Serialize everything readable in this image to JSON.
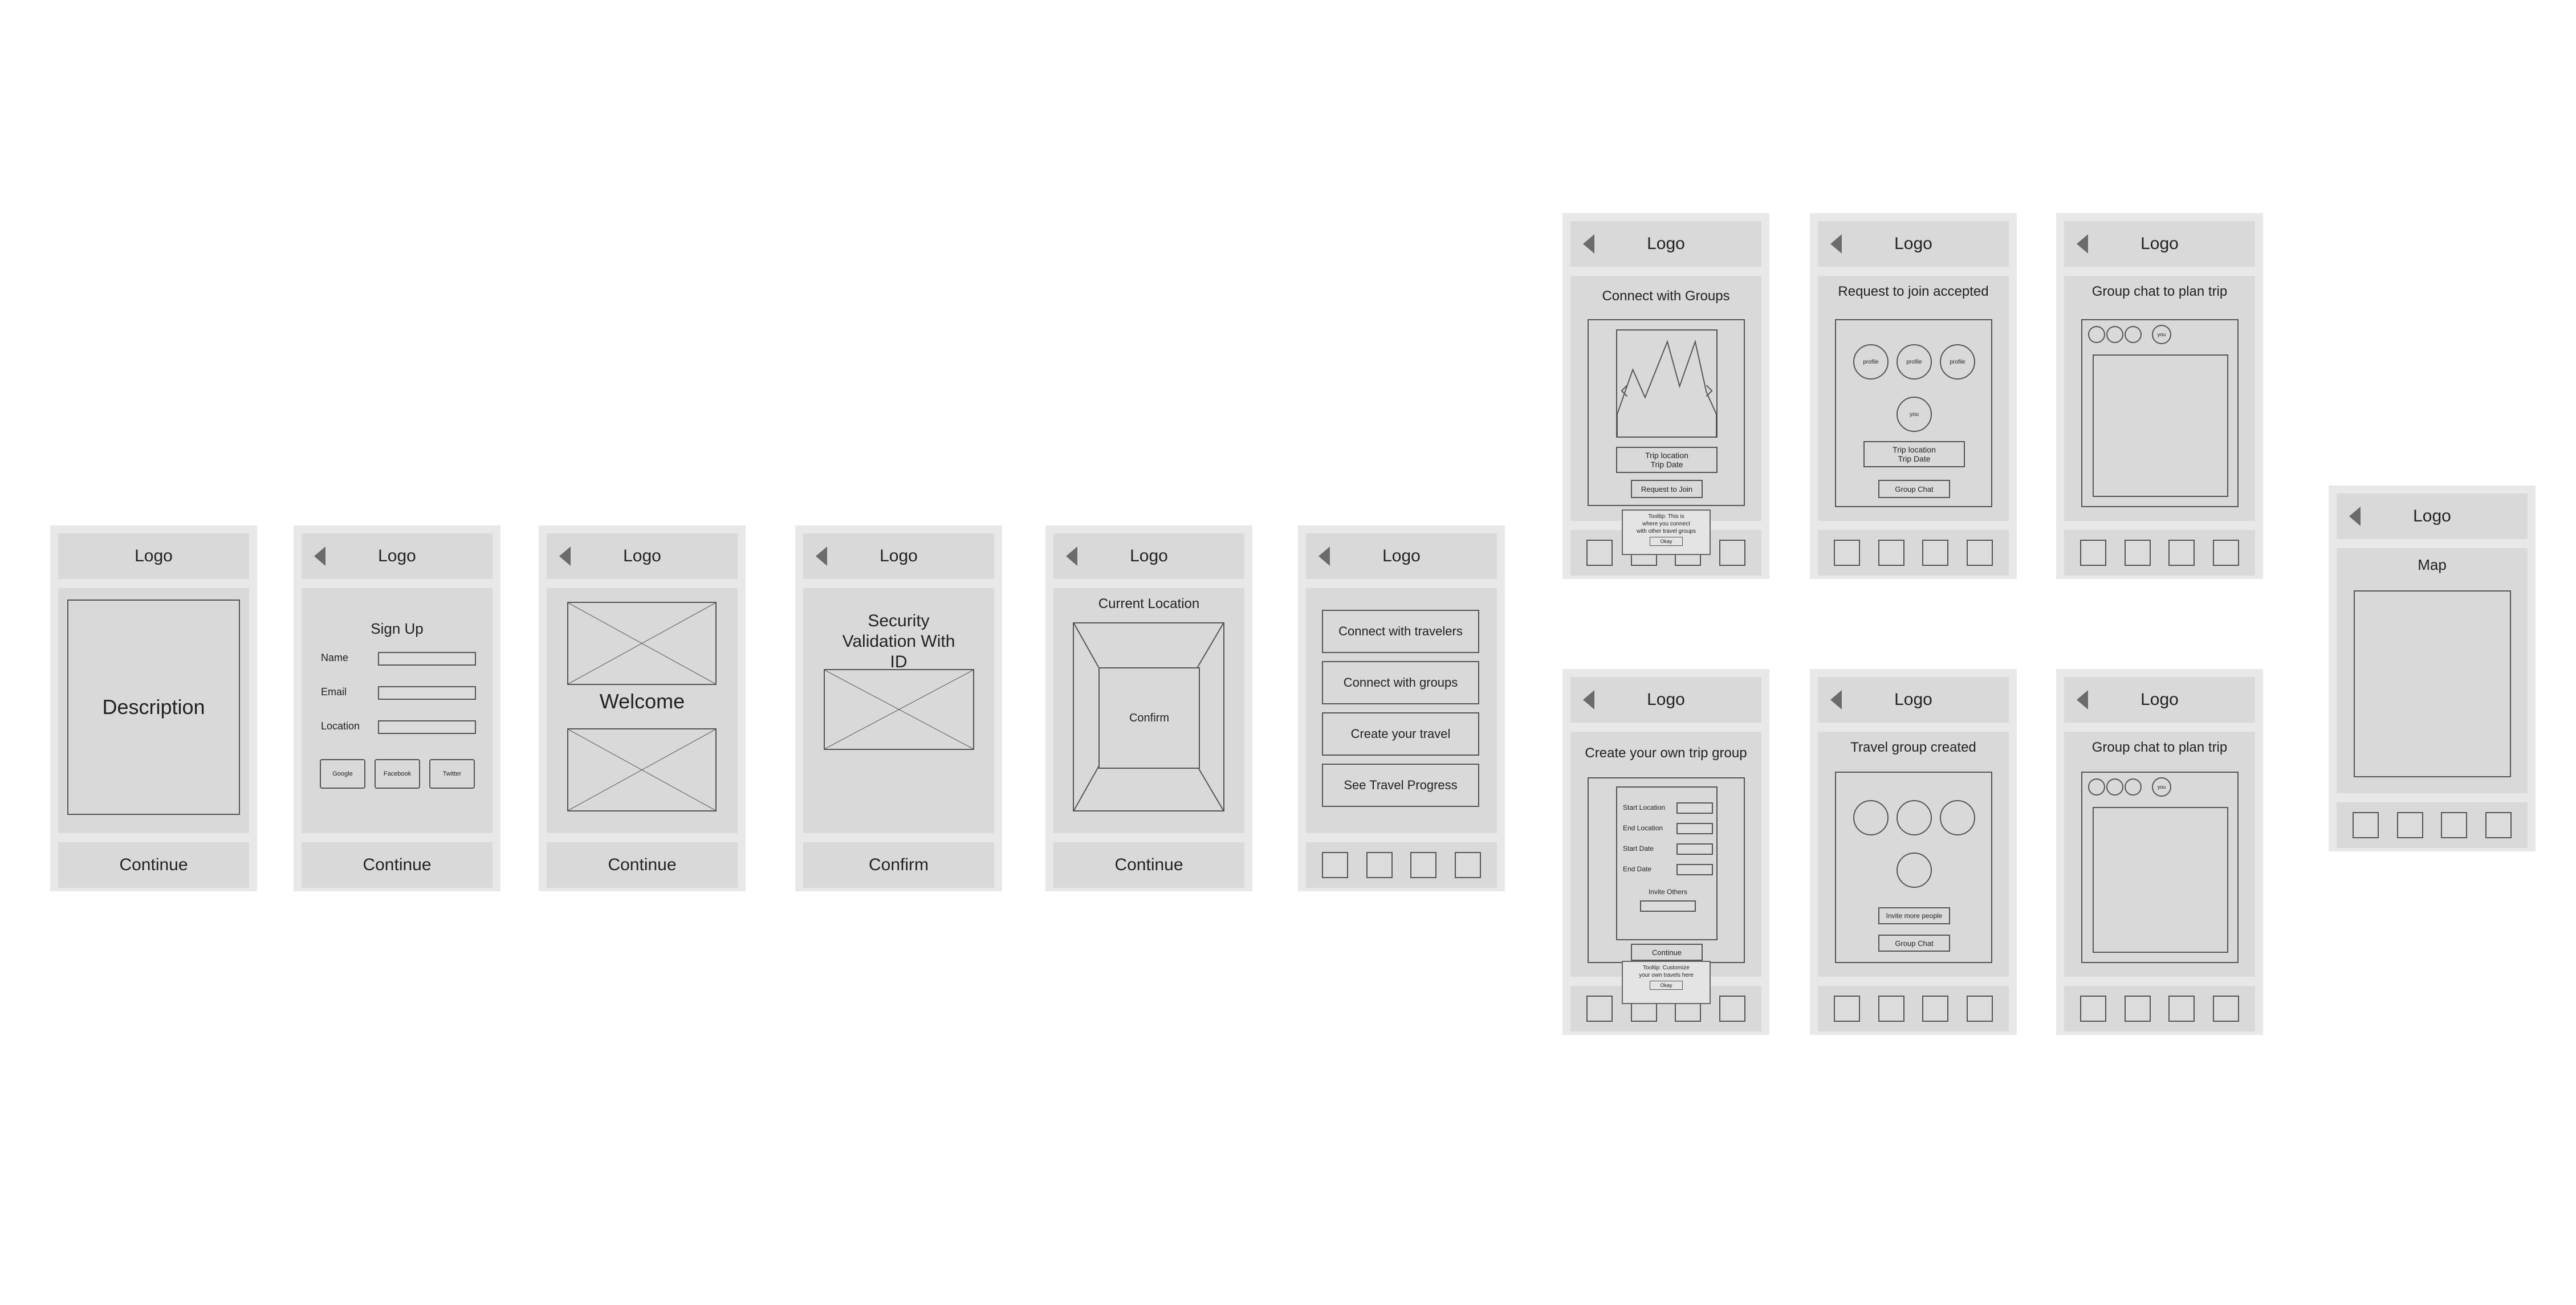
{
  "colors": {
    "frame": "#e8e8e8",
    "panel": "#d9d9d9",
    "stroke": "#555555",
    "back_arrow": "#6b6b6b"
  },
  "common": {
    "logo": "Logo",
    "continue": "Continue",
    "confirm": "Confirm"
  },
  "screen1": {
    "description": "Description"
  },
  "screen2": {
    "title": "Sign Up",
    "name_label": "Name",
    "email_label": "Email",
    "location_label": "Location",
    "google": "Google",
    "facebook": "Facebook",
    "twitter": "Twitter"
  },
  "screen3": {
    "title": "Welcome"
  },
  "screen4": {
    "title": "Security Validation With ID"
  },
  "screen5": {
    "title": "Current Location",
    "inner": "Confirm"
  },
  "screen6": {
    "menu": [
      "Connect with travelers",
      "Connect with groups",
      "Create your travel",
      "See Travel Progress"
    ]
  },
  "screen7": {
    "title": "Connect with Groups",
    "trip_location": "Trip location",
    "trip_date": "Trip Date",
    "request": "Request to Join",
    "tooltip": [
      "Tooltip: This is",
      "where you connect",
      "with other travel groups"
    ],
    "okay": "Okay"
  },
  "screen8": {
    "title": "Request to join accepted",
    "profile": "profile",
    "you": "you",
    "trip_location": "Trip location",
    "trip_date": "Trip Date",
    "group_chat": "Group Chat"
  },
  "screen9": {
    "title": "Group chat to plan trip",
    "you": "you"
  },
  "screen10": {
    "title": "Create your own trip group",
    "start_location": "Start Location",
    "end_location": "End Location",
    "start_date": "Start Date",
    "end_date": "End Date",
    "invite_others": "Invite Others",
    "continue": "Continue",
    "tooltip": [
      "Tooltip: Customize",
      "your own travels here"
    ],
    "okay": "Okay"
  },
  "screen11": {
    "title": "Travel group created",
    "invite": "Invite more people",
    "group_chat": "Group Chat"
  },
  "screen12": {
    "title": "Group chat to plan trip",
    "you": "you"
  },
  "screen13": {
    "title": "Map"
  }
}
